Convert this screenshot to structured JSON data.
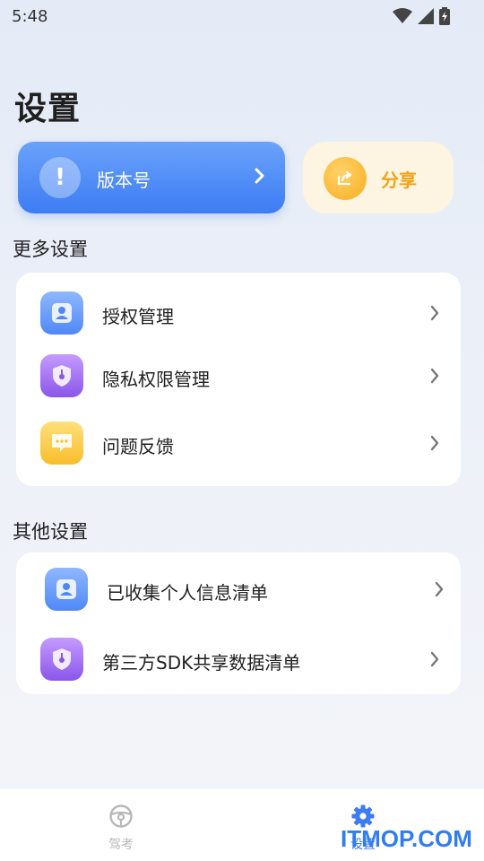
{
  "status_bar": {
    "time": "5:48"
  },
  "page": {
    "title": "设置"
  },
  "version_card": {
    "label": "版本号",
    "icon": "exclamation-icon"
  },
  "share_card": {
    "label": "分享",
    "icon": "share-icon"
  },
  "more_settings": {
    "title": "更多设置",
    "items": [
      {
        "label": "授权管理",
        "icon": "user-card-icon"
      },
      {
        "label": "隐私权限管理",
        "icon": "shield-lock-icon"
      },
      {
        "label": "问题反馈",
        "icon": "chat-bubble-icon"
      }
    ]
  },
  "other_settings": {
    "title": "其他设置",
    "items": [
      {
        "label": "已收集个人信息清单",
        "icon": "user-card-icon"
      },
      {
        "label": "第三方SDK共享数据清单",
        "icon": "shield-lock-icon"
      }
    ]
  },
  "bottom_nav": {
    "items": [
      {
        "label": "驾考",
        "icon": "steering-wheel-icon",
        "active": false
      },
      {
        "label": "设置",
        "icon": "gear-icon",
        "active": true
      }
    ]
  },
  "watermark": {
    "text": "ITMOP.COM"
  },
  "colors": {
    "accent": "#3d7cf4",
    "share": "#f0a316",
    "purple": "#8a56ea"
  }
}
